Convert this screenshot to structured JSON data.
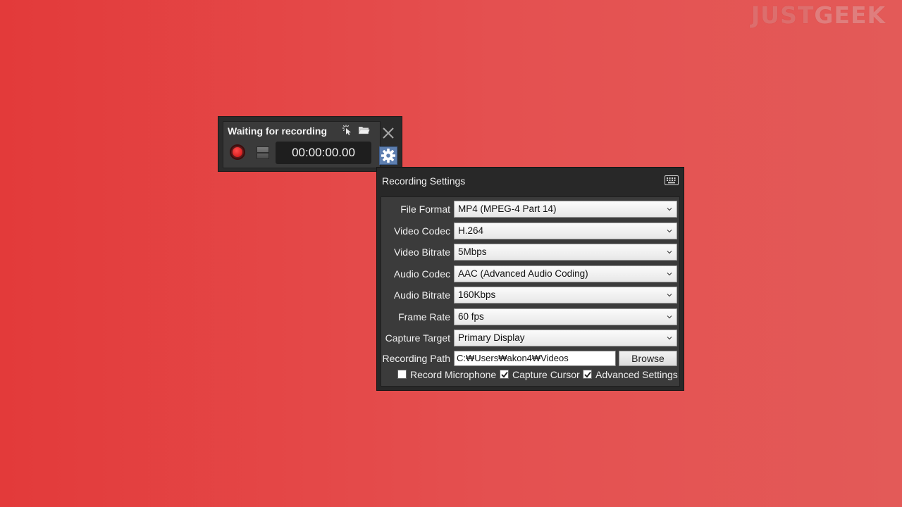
{
  "watermark": {
    "part1": "JUST",
    "part2": "GEEK"
  },
  "recorder": {
    "status": "Waiting for recording",
    "timer": "00:00:00.00",
    "icons": [
      "cursor-click-icon",
      "folder-icon",
      "record-icon",
      "stop-icon",
      "close-icon",
      "gear-icon"
    ],
    "colors": {
      "record": "#e01818",
      "settings_button": "#5e7fb0"
    }
  },
  "settings": {
    "title": "Recording Settings",
    "icons": [
      "keyboard-icon",
      "chevron-down-icon"
    ],
    "fields": [
      {
        "label": "File Format",
        "value": "MP4 (MPEG-4 Part 14)"
      },
      {
        "label": "Video Codec",
        "value": "H.264"
      },
      {
        "label": "Video Bitrate",
        "value": "5Mbps"
      },
      {
        "label": "Audio Codec",
        "value": "AAC (Advanced Audio Coding)"
      },
      {
        "label": "Audio Bitrate",
        "value": "160Kbps"
      },
      {
        "label": "Frame Rate",
        "value": "60 fps"
      },
      {
        "label": "Capture Target",
        "value": "Primary Display"
      }
    ],
    "path": {
      "label": "Recording Path",
      "value": "C:₩Users₩akon4₩Videos",
      "button": "Browse"
    },
    "checkboxes": [
      {
        "label": "Record Microphone",
        "checked": false
      },
      {
        "label": "Capture Cursor",
        "checked": true
      },
      {
        "label": "Advanced Settings",
        "checked": true
      }
    ]
  }
}
